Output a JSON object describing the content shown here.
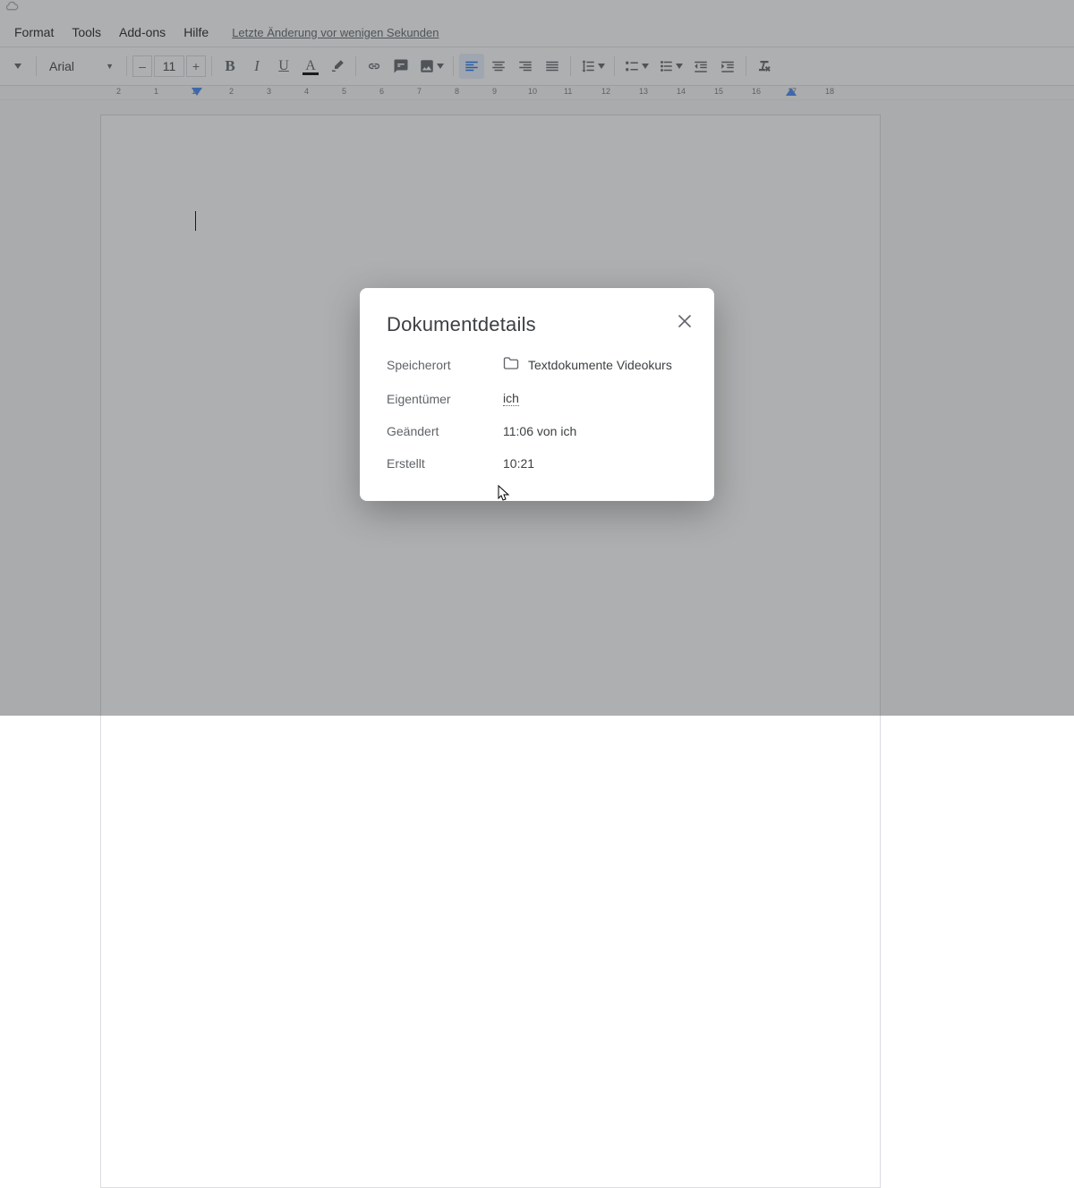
{
  "menubar": {
    "format": "Format",
    "tools": "Tools",
    "addons": "Add-ons",
    "help": "Hilfe",
    "last_edit": "Letzte Änderung vor wenigen Sekunden"
  },
  "toolbar": {
    "font_name": "Arial",
    "font_size": "11",
    "minus": "–",
    "plus": "+"
  },
  "ruler": {
    "labels": [
      "2",
      "1",
      "1",
      "2",
      "3",
      "4",
      "5",
      "6",
      "7",
      "8",
      "9",
      "10",
      "11",
      "12",
      "13",
      "14",
      "15",
      "16",
      "17",
      "18"
    ]
  },
  "dialog": {
    "title": "Dokumentdetails",
    "rows": {
      "location_label": "Speicherort",
      "location_value": "Textdokumente Videokurs",
      "owner_label": "Eigentümer",
      "owner_value": "ich",
      "modified_label": "Geändert",
      "modified_value": "11:06 von ich",
      "created_label": "Erstellt",
      "created_value": "10:21"
    }
  }
}
